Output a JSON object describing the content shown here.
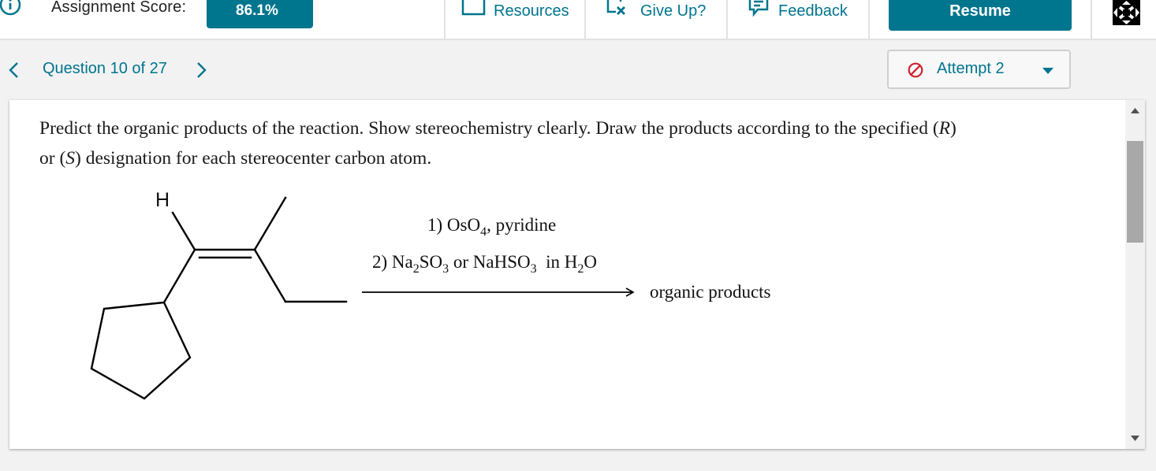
{
  "topbar": {
    "info_icon": "info-circle-icon",
    "score_label": "Assignment Score:",
    "score_value": "86.1%",
    "resources_label": "Resources",
    "resources_icon": "resources-square-icon",
    "give_up_label": "Give Up?",
    "give_up_icon": "give-up-icon",
    "feedback_label": "Feedback",
    "feedback_icon": "feedback-speech-bubble-icon",
    "resume_label": "Resume",
    "fullscreen_icon": "fullscreen-arrows-icon"
  },
  "nav": {
    "prev_icon": "chevron-left-icon",
    "question_label": "Question 10 of 27",
    "next_icon": "chevron-right-icon",
    "attempt_label": "Attempt 2",
    "attempt_icon": "no-entry-icon",
    "attempt_dropdown_icon": "caret-down-icon"
  },
  "question": {
    "prompt_line1_a": "Predict the organic products of the reaction. Show stereochemistry clearly. Draw the products according to the specified (",
    "prompt_line1_r": "R",
    "prompt_line1_b": ")",
    "prompt_line2_a": "or (",
    "prompt_line2_s": "S",
    "prompt_line2_b": ") designation for each stereocenter carbon atom."
  },
  "reaction": {
    "h_label": "H",
    "step1_prefix": "1) OsO",
    "step1_sub": "4",
    "step1_suffix": ", pyridine",
    "step2_prefix": "2) Na",
    "step2_sub1": "2",
    "step2_mid1": "SO",
    "step2_sub2": "3",
    "step2_mid2": " or NaHSO",
    "step2_sub3": "3",
    "step2_mid3": "  in H",
    "step2_sub4": "2",
    "step2_suffix": "O",
    "product_label": "organic products"
  },
  "colors": {
    "brand": "#00758e",
    "error": "#d0202e",
    "scroll_thumb": "#a8a8a8"
  }
}
